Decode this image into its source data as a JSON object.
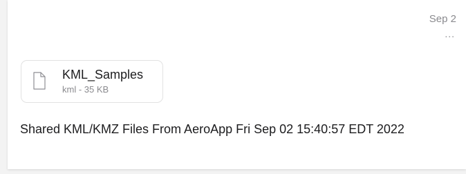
{
  "message": {
    "date": "Sep 2",
    "more_label": "...",
    "body": "Shared KML/KMZ Files From AeroApp Fri Sep 02 15:40:57 EDT 2022"
  },
  "attachment": {
    "icon": "document-icon",
    "name": "KML_Samples",
    "meta": "kml - 35 KB"
  },
  "colors": {
    "primary_text": "#1c1c1e",
    "secondary_text": "#8a8a8e",
    "border": "#e2e2e2"
  }
}
